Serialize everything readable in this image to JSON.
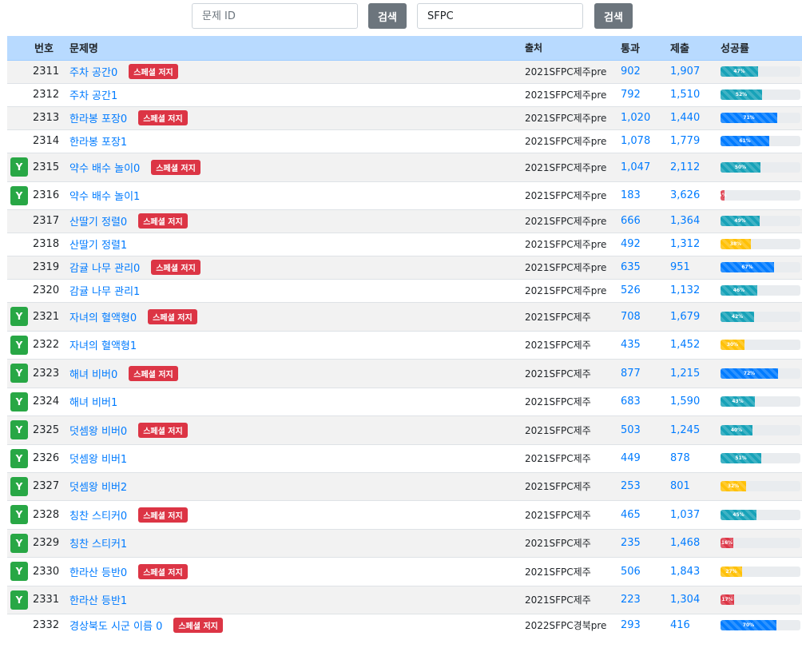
{
  "search": {
    "id_placeholder": "문제 ID",
    "id_value": "",
    "source_value": "SFPC",
    "button_label": "검색"
  },
  "table": {
    "headers": {
      "status": "",
      "id": "번호",
      "title": "문제명",
      "source": "출처",
      "accepted": "통과",
      "submitted": "제출",
      "rate": "성공률"
    },
    "special_label": "스페셜 저지",
    "solved_label": "Y",
    "rows": [
      {
        "solved": false,
        "id": "2311",
        "title": "주차 공간0",
        "special": true,
        "source": "2021SFPC제주pre",
        "accepted": "902",
        "submitted": "1,907",
        "rate": 47,
        "rate_label": "47%",
        "color": "info"
      },
      {
        "solved": false,
        "id": "2312",
        "title": "주차 공간1",
        "special": false,
        "source": "2021SFPC제주pre",
        "accepted": "792",
        "submitted": "1,510",
        "rate": 52,
        "rate_label": "52%",
        "color": "info"
      },
      {
        "solved": false,
        "id": "2313",
        "title": "한라봉 포장0",
        "special": true,
        "source": "2021SFPC제주pre",
        "accepted": "1,020",
        "submitted": "1,440",
        "rate": 71,
        "rate_label": "71%",
        "color": "primary"
      },
      {
        "solved": false,
        "id": "2314",
        "title": "한라봉 포장1",
        "special": false,
        "source": "2021SFPC제주pre",
        "accepted": "1,078",
        "submitted": "1,779",
        "rate": 61,
        "rate_label": "61%",
        "color": "primary"
      },
      {
        "solved": true,
        "id": "2315",
        "title": "약수 배수 놀이0",
        "special": true,
        "source": "2021SFPC제주pre",
        "accepted": "1,047",
        "submitted": "2,112",
        "rate": 50,
        "rate_label": "50%",
        "color": "info"
      },
      {
        "solved": true,
        "id": "2316",
        "title": "약수 배수 놀이1",
        "special": false,
        "source": "2021SFPC제주pre",
        "accepted": "183",
        "submitted": "3,626",
        "rate": 5,
        "rate_label": "5%",
        "color": "danger"
      },
      {
        "solved": false,
        "id": "2317",
        "title": "산딸기 정렬0",
        "special": true,
        "source": "2021SFPC제주pre",
        "accepted": "666",
        "submitted": "1,364",
        "rate": 49,
        "rate_label": "49%",
        "color": "info"
      },
      {
        "solved": false,
        "id": "2318",
        "title": "산딸기 정렬1",
        "special": false,
        "source": "2021SFPC제주pre",
        "accepted": "492",
        "submitted": "1,312",
        "rate": 38,
        "rate_label": "38%",
        "color": "warning"
      },
      {
        "solved": false,
        "id": "2319",
        "title": "감귤 나무 관리0",
        "special": true,
        "source": "2021SFPC제주pre",
        "accepted": "635",
        "submitted": "951",
        "rate": 67,
        "rate_label": "67%",
        "color": "primary"
      },
      {
        "solved": false,
        "id": "2320",
        "title": "감귤 나무 관리1",
        "special": false,
        "source": "2021SFPC제주pre",
        "accepted": "526",
        "submitted": "1,132",
        "rate": 46,
        "rate_label": "46%",
        "color": "info"
      },
      {
        "solved": true,
        "id": "2321",
        "title": "자녀의 혈액형0",
        "special": true,
        "source": "2021SFPC제주",
        "accepted": "708",
        "submitted": "1,679",
        "rate": 42,
        "rate_label": "42%",
        "color": "info"
      },
      {
        "solved": true,
        "id": "2322",
        "title": "자녀의 혈액형1",
        "special": false,
        "source": "2021SFPC제주",
        "accepted": "435",
        "submitted": "1,452",
        "rate": 30,
        "rate_label": "30%",
        "color": "warning"
      },
      {
        "solved": true,
        "id": "2323",
        "title": "해녀 비버0",
        "special": true,
        "source": "2021SFPC제주",
        "accepted": "877",
        "submitted": "1,215",
        "rate": 72,
        "rate_label": "72%",
        "color": "primary"
      },
      {
        "solved": true,
        "id": "2324",
        "title": "해녀 비버1",
        "special": false,
        "source": "2021SFPC제주",
        "accepted": "683",
        "submitted": "1,590",
        "rate": 43,
        "rate_label": "43%",
        "color": "info"
      },
      {
        "solved": true,
        "id": "2325",
        "title": "덧셈왕 비버0",
        "special": true,
        "source": "2021SFPC제주",
        "accepted": "503",
        "submitted": "1,245",
        "rate": 40,
        "rate_label": "40%",
        "color": "info"
      },
      {
        "solved": true,
        "id": "2326",
        "title": "덧셈왕 비버1",
        "special": false,
        "source": "2021SFPC제주",
        "accepted": "449",
        "submitted": "878",
        "rate": 51,
        "rate_label": "51%",
        "color": "info"
      },
      {
        "solved": true,
        "id": "2327",
        "title": "덧셈왕 비버2",
        "special": false,
        "source": "2021SFPC제주",
        "accepted": "253",
        "submitted": "801",
        "rate": 32,
        "rate_label": "32%",
        "color": "warning"
      },
      {
        "solved": true,
        "id": "2328",
        "title": "칭찬 스티커0",
        "special": true,
        "source": "2021SFPC제주",
        "accepted": "465",
        "submitted": "1,037",
        "rate": 45,
        "rate_label": "45%",
        "color": "info"
      },
      {
        "solved": true,
        "id": "2329",
        "title": "칭찬 스티커1",
        "special": false,
        "source": "2021SFPC제주",
        "accepted": "235",
        "submitted": "1,468",
        "rate": 16,
        "rate_label": "16%",
        "color": "danger"
      },
      {
        "solved": true,
        "id": "2330",
        "title": "한라산 등반0",
        "special": true,
        "source": "2021SFPC제주",
        "accepted": "506",
        "submitted": "1,843",
        "rate": 27,
        "rate_label": "27%",
        "color": "warning"
      },
      {
        "solved": true,
        "id": "2331",
        "title": "한라산 등반1",
        "special": false,
        "source": "2021SFPC제주",
        "accepted": "223",
        "submitted": "1,304",
        "rate": 17,
        "rate_label": "17%",
        "color": "danger"
      },
      {
        "solved": false,
        "id": "2332",
        "title": "경상북도 시군 이름 0",
        "special": true,
        "source": "2022SFPC경북pre",
        "accepted": "293",
        "submitted": "416",
        "rate": 70,
        "rate_label": "70%",
        "color": "primary"
      }
    ]
  }
}
